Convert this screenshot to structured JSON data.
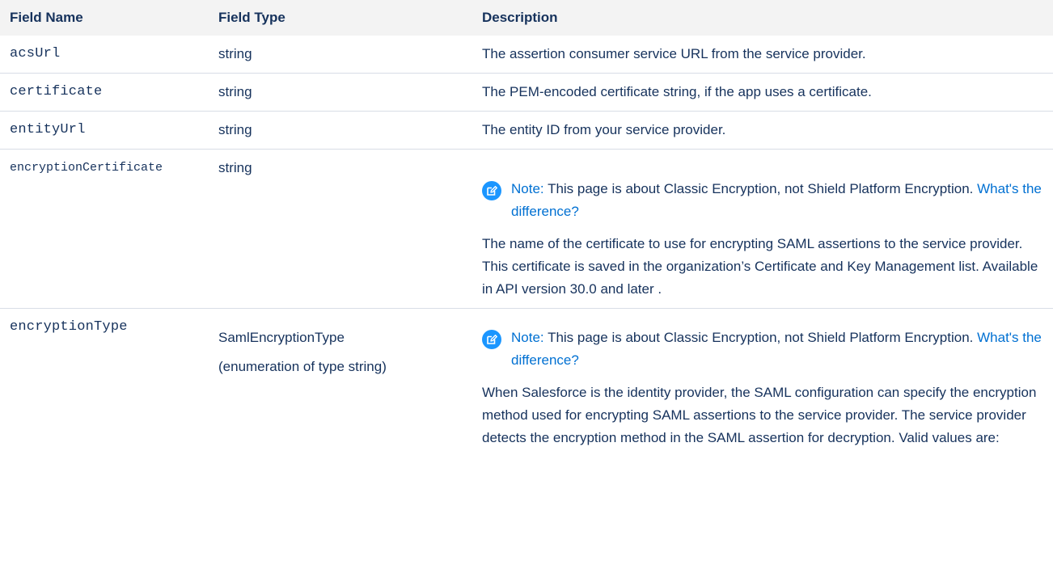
{
  "table": {
    "headers": {
      "name": "Field Name",
      "type": "Field Type",
      "description": "Description"
    },
    "rows": [
      {
        "name": "acsUrl",
        "type": "string",
        "description": "The assertion consumer service URL from the service provider."
      },
      {
        "name": "certificate",
        "type": "string",
        "description": "The PEM-encoded certificate string, if the app uses a certificate."
      },
      {
        "name": "entityUrl",
        "type": "string",
        "description": "The entity ID from your service provider."
      },
      {
        "name": "encryptionCertificate",
        "type": "string",
        "note": {
          "label": "Note:",
          "text": "This page is about Classic Encryption, not Shield Platform Encryption.",
          "link": "What's the difference?"
        },
        "description": "The name of the certificate to use for encrypting SAML assertions to the service provider. This certificate is saved in the organization’s Certificate and Key Management list. Available in API version 30.0 and later ."
      },
      {
        "name": "encryptionType",
        "type": "SamlEncryptionType",
        "type_sub": "(enumeration of type string)",
        "note": {
          "label": "Note:",
          "text": "This page is about Classic Encryption, not Shield Platform Encryption.",
          "link": "What's the difference?"
        },
        "description": "When Salesforce is the identity provider, the SAML configuration can specify the encryption method used for encrypting SAML assertions to the service provider. The service provider detects the encryption method in the SAML assertion for decryption. Valid values are:"
      }
    ]
  },
  "colors": {
    "text": "#16325c",
    "link": "#0070d2",
    "note_icon": "#1b96ff",
    "header_bg": "#f3f3f3"
  }
}
